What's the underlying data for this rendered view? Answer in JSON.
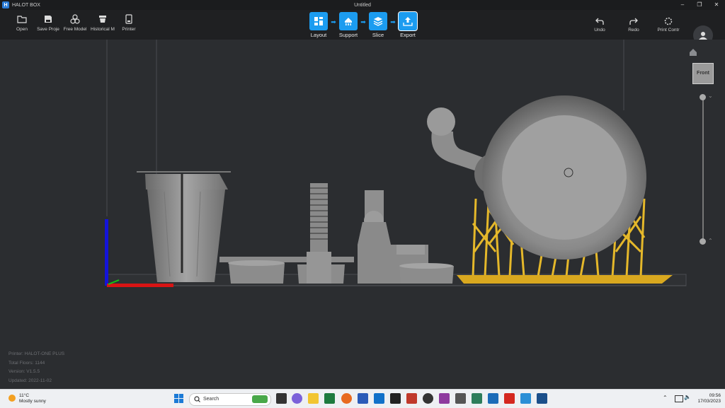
{
  "app": {
    "name": "HALOT BOX",
    "title": "Untitled"
  },
  "toolbar": {
    "left": [
      "Open",
      "Save Proje",
      "Free Model",
      "Historical M",
      "Printer"
    ],
    "workflow": [
      "Layout",
      "Support",
      "Slice",
      "Export"
    ],
    "right": [
      "Undo",
      "Redo",
      "Print Contr"
    ]
  },
  "view": {
    "front_label": "Front"
  },
  "info": {
    "printer": "Printer: HALOT-ONE PLUS",
    "total_floors": "Total Floors: 1144",
    "version": "Version: V1.5.5",
    "updated": "Updated:  2022-11-02"
  },
  "taskbar": {
    "temp": "11°C",
    "weather": "Mostly sunny",
    "search_placeholder": "Search",
    "time": "09:56",
    "date": "17/03/2023"
  },
  "colors": {
    "accent": "#1c9cf0",
    "support": "#e5b82a",
    "background": "#2b2d30"
  }
}
